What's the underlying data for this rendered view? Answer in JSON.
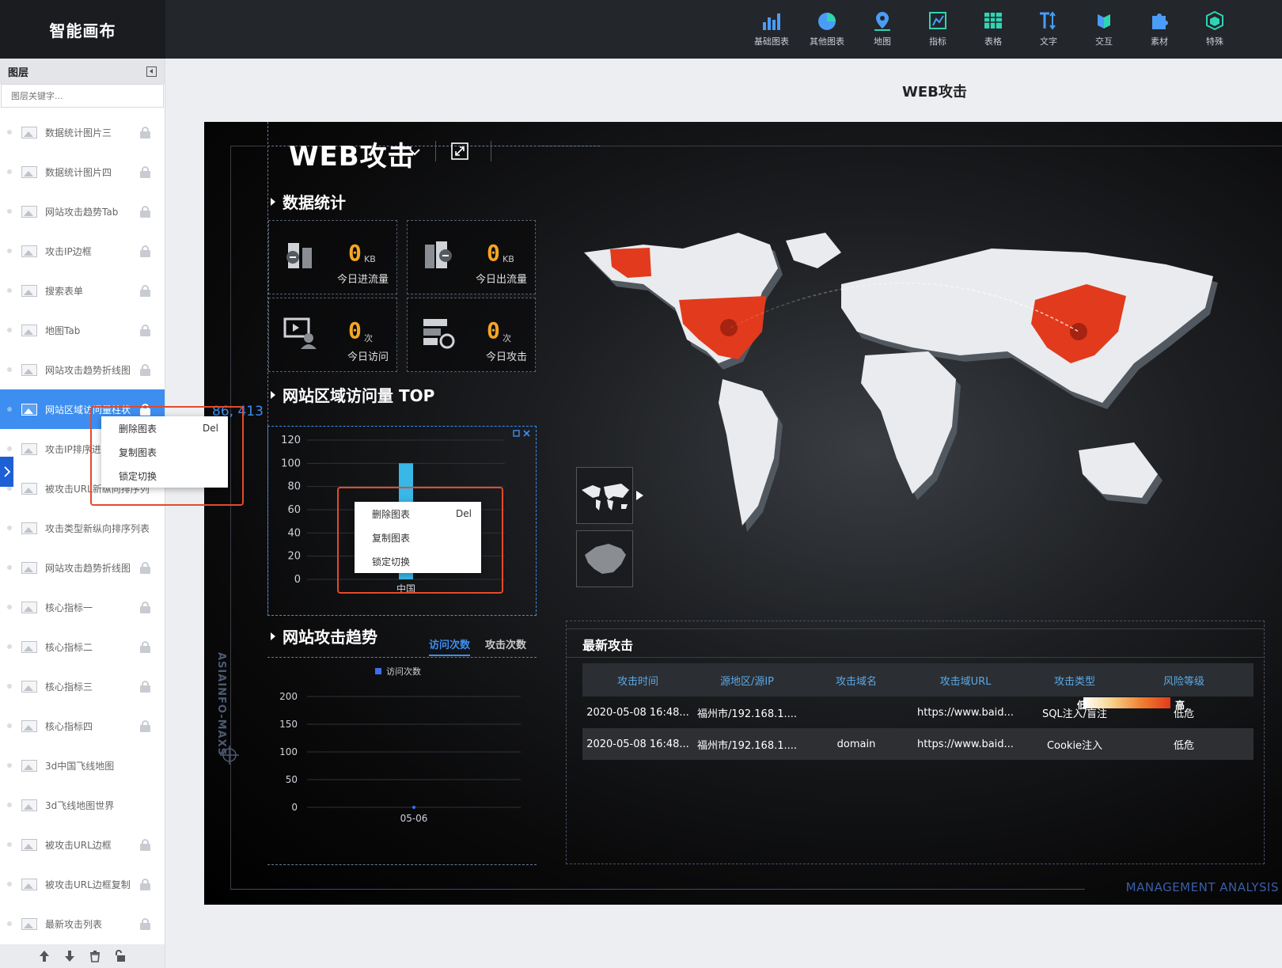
{
  "app": {
    "title": "智能画布"
  },
  "toolbar": [
    {
      "label": "基础图表",
      "icon": "bar-chart-icon"
    },
    {
      "label": "其他图表",
      "icon": "pie-chart-icon"
    },
    {
      "label": "地图",
      "icon": "map-pin-icon"
    },
    {
      "label": "指标",
      "icon": "indicator-icon"
    },
    {
      "label": "表格",
      "icon": "table-icon"
    },
    {
      "label": "文字",
      "icon": "text-icon"
    },
    {
      "label": "交互",
      "icon": "interaction-icon"
    },
    {
      "label": "素材",
      "icon": "puzzle-icon"
    },
    {
      "label": "特殊",
      "icon": "cube-icon"
    }
  ],
  "layers": {
    "title": "图层",
    "search_placeholder": "图层关键字...",
    "items": [
      {
        "label": "数据统计图片三",
        "locked": true
      },
      {
        "label": "数据统计图片四",
        "locked": true
      },
      {
        "label": "网站攻击趋势Tab",
        "locked": true
      },
      {
        "label": "攻击IP边框",
        "locked": true
      },
      {
        "label": "搜索表单",
        "locked": true
      },
      {
        "label": "地图Tab",
        "locked": true
      },
      {
        "label": "网站攻击趋势折线图",
        "locked": true
      },
      {
        "label": "网站区域访问量柱状",
        "locked": true,
        "active": true
      },
      {
        "label": "攻击IP排序进度",
        "locked": false
      },
      {
        "label": "被攻击URL新纵向排序列",
        "locked": false
      },
      {
        "label": "攻击类型新纵向排序列表",
        "locked": false
      },
      {
        "label": "网站攻击趋势折线图",
        "locked": true
      },
      {
        "label": "核心指标一",
        "locked": true
      },
      {
        "label": "核心指标二",
        "locked": true
      },
      {
        "label": "核心指标三",
        "locked": true
      },
      {
        "label": "核心指标四",
        "locked": true
      },
      {
        "label": "3d中国飞线地图",
        "locked": false
      },
      {
        "label": "3d飞线地图世界",
        "locked": false
      },
      {
        "label": "被攻击URL边框",
        "locked": true
      },
      {
        "label": "被攻击URL边框复制",
        "locked": true
      },
      {
        "label": "最新攻击列表",
        "locked": true
      }
    ]
  },
  "context_menu": {
    "items": [
      {
        "label": "删除图表",
        "shortcut": "Del"
      },
      {
        "label": "复制图表",
        "shortcut": ""
      },
      {
        "label": "锁定切换",
        "shortcut": ""
      }
    ]
  },
  "canvas": {
    "page_title": "WEB攻击",
    "coords": "86, 413",
    "dashboard_title": "WEB攻击",
    "vertical_brand": "ASIAINFO-MAXS",
    "footer_brand": "MANAGEMENT ANALYSIS",
    "sections": {
      "stats": "数据统计",
      "region": "网站区域访问量 TOP",
      "trend": "网站攻击趋势",
      "latest": "最新攻击"
    },
    "stats": [
      {
        "value": "0",
        "unit": "KB",
        "label": "今日进流量"
      },
      {
        "value": "0",
        "unit": "KB",
        "label": "今日出流量"
      },
      {
        "value": "0",
        "unit": "次",
        "label": "今日访问"
      },
      {
        "value": "0",
        "unit": "次",
        "label": "今日攻击"
      }
    ],
    "trend_tabs": [
      {
        "label": "访问次数",
        "active": true
      },
      {
        "label": "攻击次数",
        "active": false
      }
    ],
    "map_legend": {
      "min": "0",
      "max": "10",
      "low_label": "低",
      "high_label": "高"
    },
    "table": {
      "columns": [
        "攻击时间",
        "源地区/源IP",
        "攻击域名",
        "攻击域URL",
        "攻击类型",
        "风险等级"
      ],
      "rows": [
        [
          "2020-05-08 16:48...",
          "福州市/192.168.1....",
          "",
          "https://www.baid...",
          "SQL注入/盲注",
          "低危"
        ],
        [
          "2020-05-08 16:48...",
          "福州市/192.168.1....",
          "domain",
          "https://www.baid...",
          "Cookie注入",
          "低危"
        ]
      ]
    },
    "colors": {
      "accent": "#3d8ef0",
      "highlight": "#e23a1c",
      "stat_value": "#f5a623",
      "bar": "#39b7e6"
    }
  },
  "chart_data": [
    {
      "type": "bar",
      "categories": [
        "中国"
      ],
      "series": [
        {
          "values": [
            100
          ]
        }
      ],
      "yticks": [
        0,
        20,
        40,
        60,
        80,
        100,
        120
      ],
      "ylim": [
        0,
        120
      ]
    },
    {
      "type": "line",
      "x": [
        "05-06"
      ],
      "series": [
        {
          "name": "访问次数",
          "values": [
            0
          ]
        }
      ],
      "yticks": [
        0,
        50,
        100,
        150,
        200
      ],
      "ylim": [
        0,
        200
      ]
    }
  ]
}
